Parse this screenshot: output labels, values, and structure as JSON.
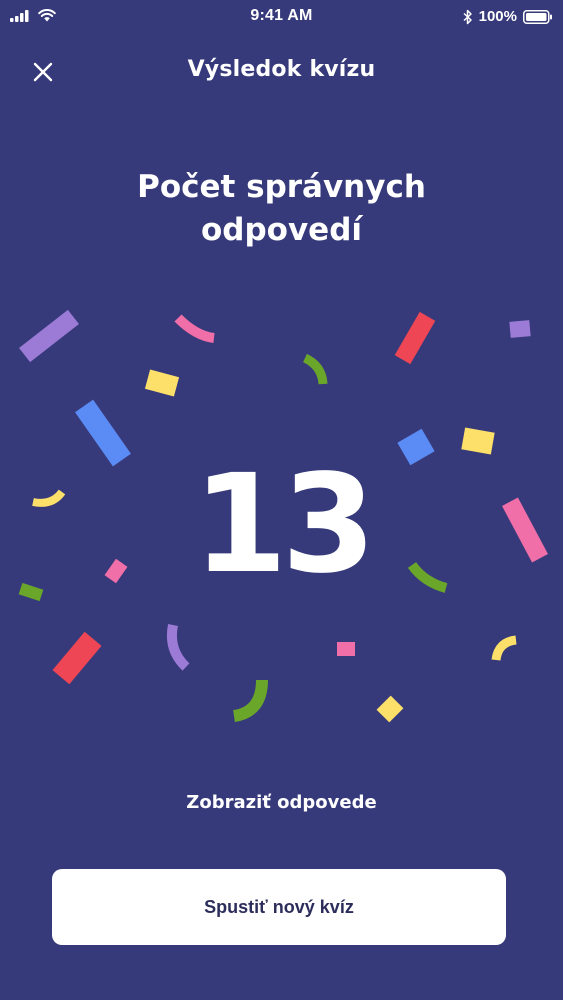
{
  "status_bar": {
    "time": "9:41 AM",
    "battery": "100%"
  },
  "header": {
    "title": "Výsledok kvízu"
  },
  "result": {
    "heading_line1": "Počet správnych",
    "heading_line2": "odpovedí",
    "score": "13"
  },
  "actions": {
    "view_answers": "Zobraziť odpovede",
    "new_quiz": "Spustiť nový kvíz"
  },
  "colors": {
    "background": "#373a7a",
    "button_bg": "#ffffff",
    "button_text": "#2c2d5a",
    "confetti_purple": "#9b7bd6",
    "confetti_pink": "#f06fa8",
    "confetti_red": "#ee4654",
    "confetti_green": "#6aa62a",
    "confetti_yellow": "#fde06a",
    "confetti_blue": "#5b8cf5"
  }
}
